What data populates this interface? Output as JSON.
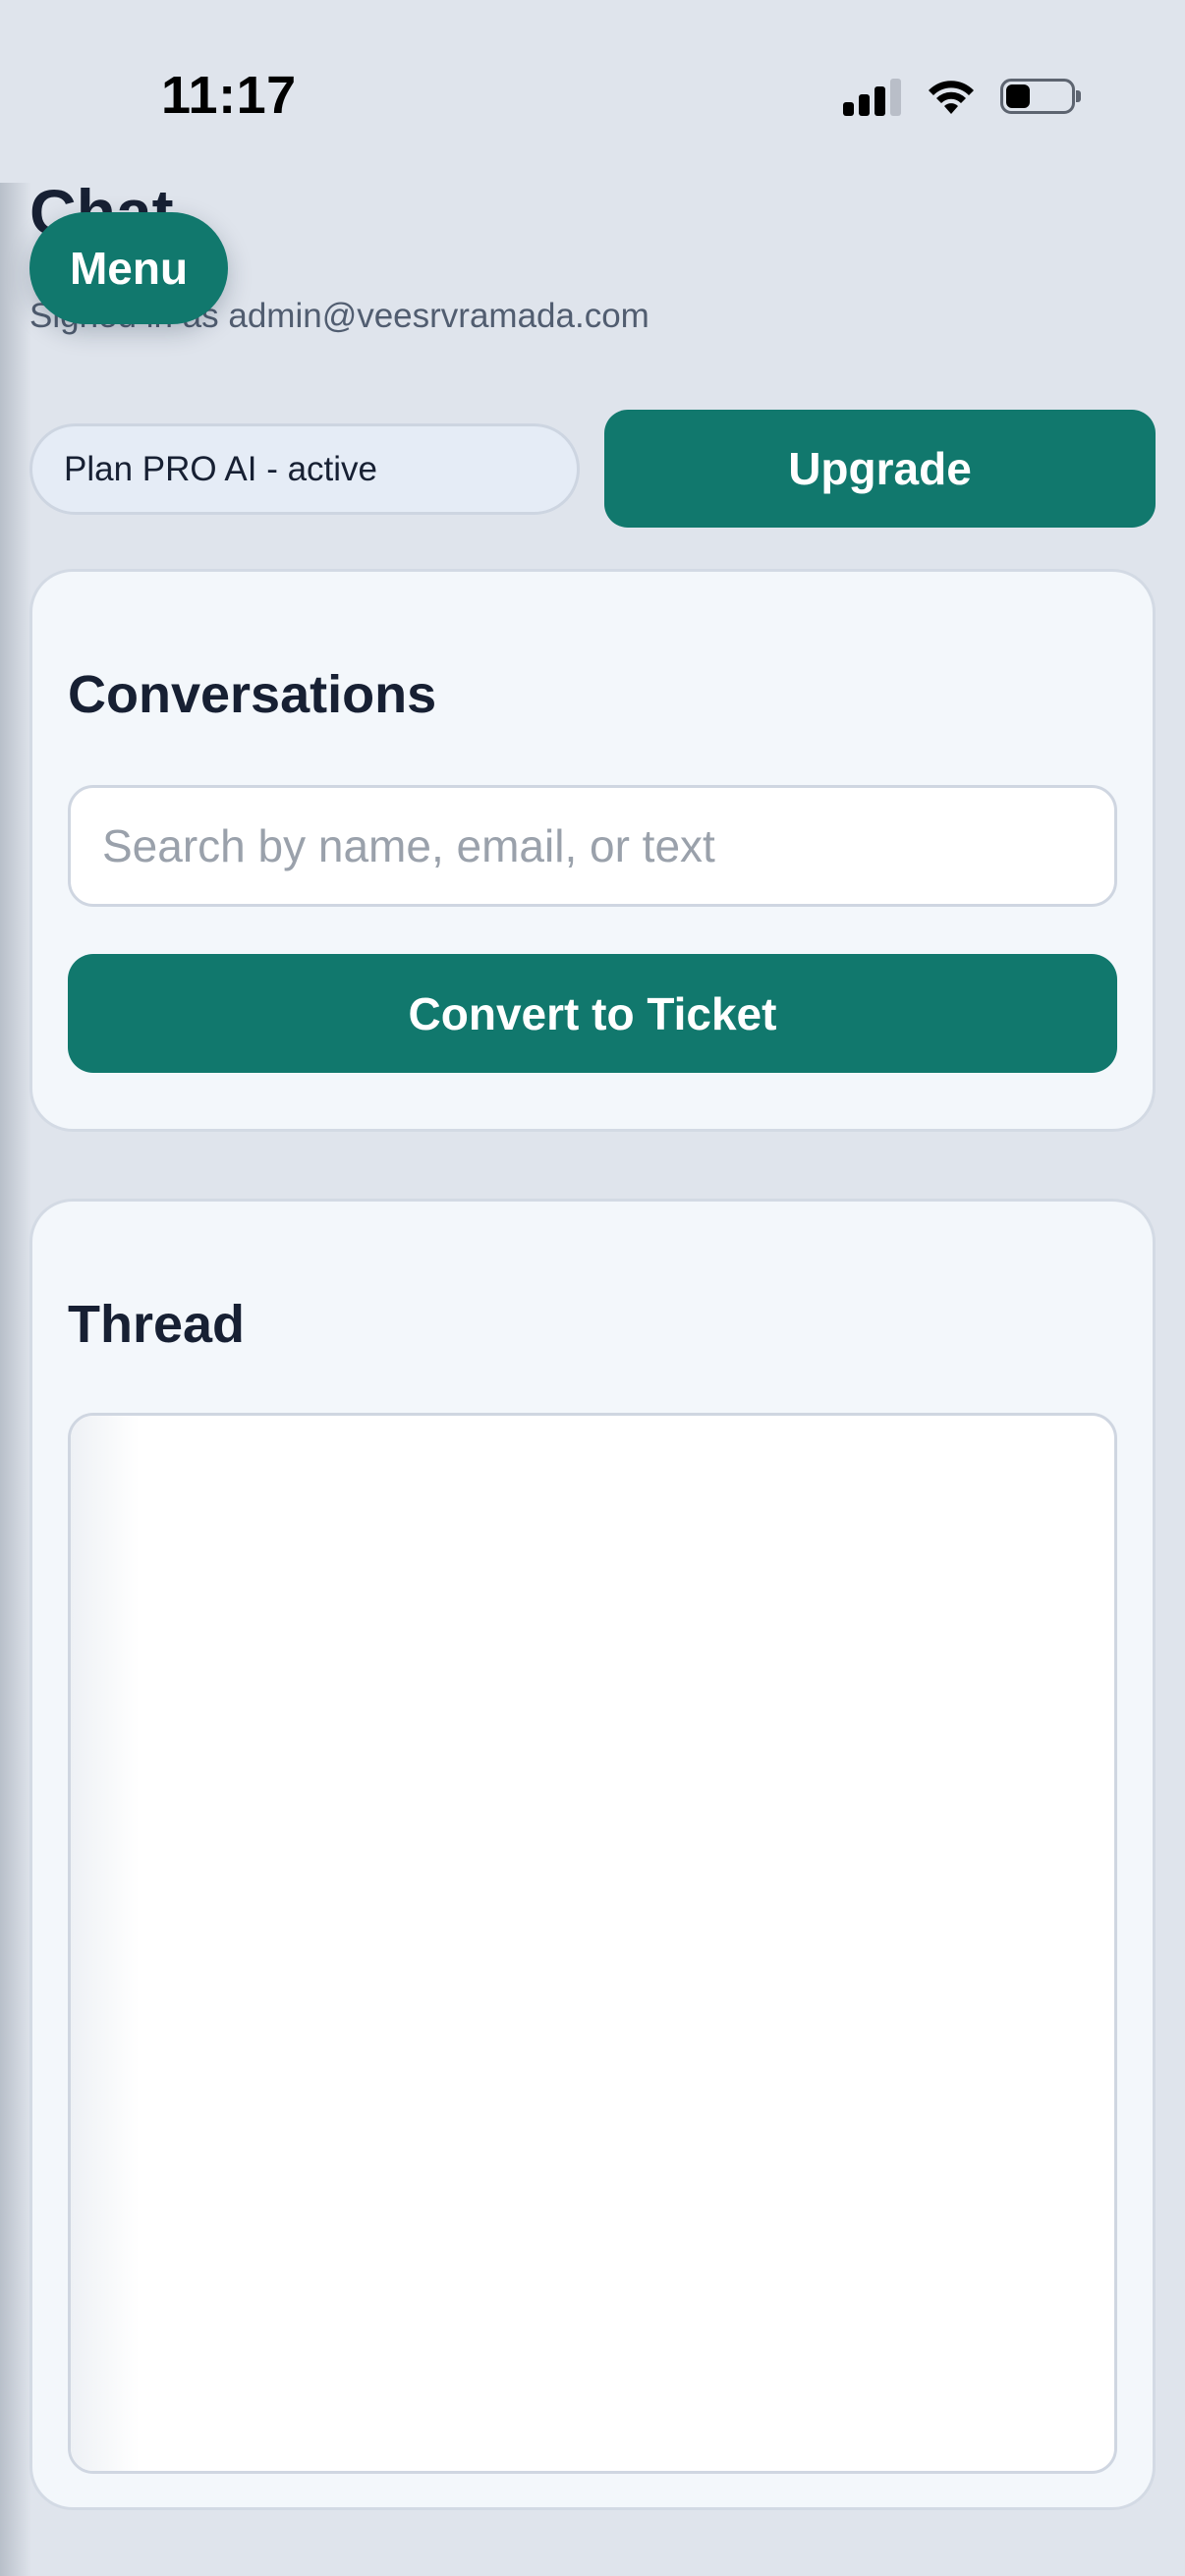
{
  "status_bar": {
    "time": "11:17",
    "icons": [
      "signal-icon",
      "wifi-icon",
      "battery-icon"
    ]
  },
  "header": {
    "title": "Chat",
    "menu_label": "Menu",
    "signed_in": "Signed in as admin@veesrvramada.com"
  },
  "plan": {
    "status_label": "Plan PRO AI - active",
    "upgrade_label": "Upgrade"
  },
  "conversations": {
    "heading": "Conversations",
    "search_placeholder": "Search by name, email, or text",
    "search_value": "",
    "convert_label": "Convert to Ticket"
  },
  "thread": {
    "heading": "Thread"
  },
  "colors": {
    "accent": "#11786d",
    "background": "#dfe4ec",
    "card": "#f3f7fb",
    "text": "#172033"
  }
}
